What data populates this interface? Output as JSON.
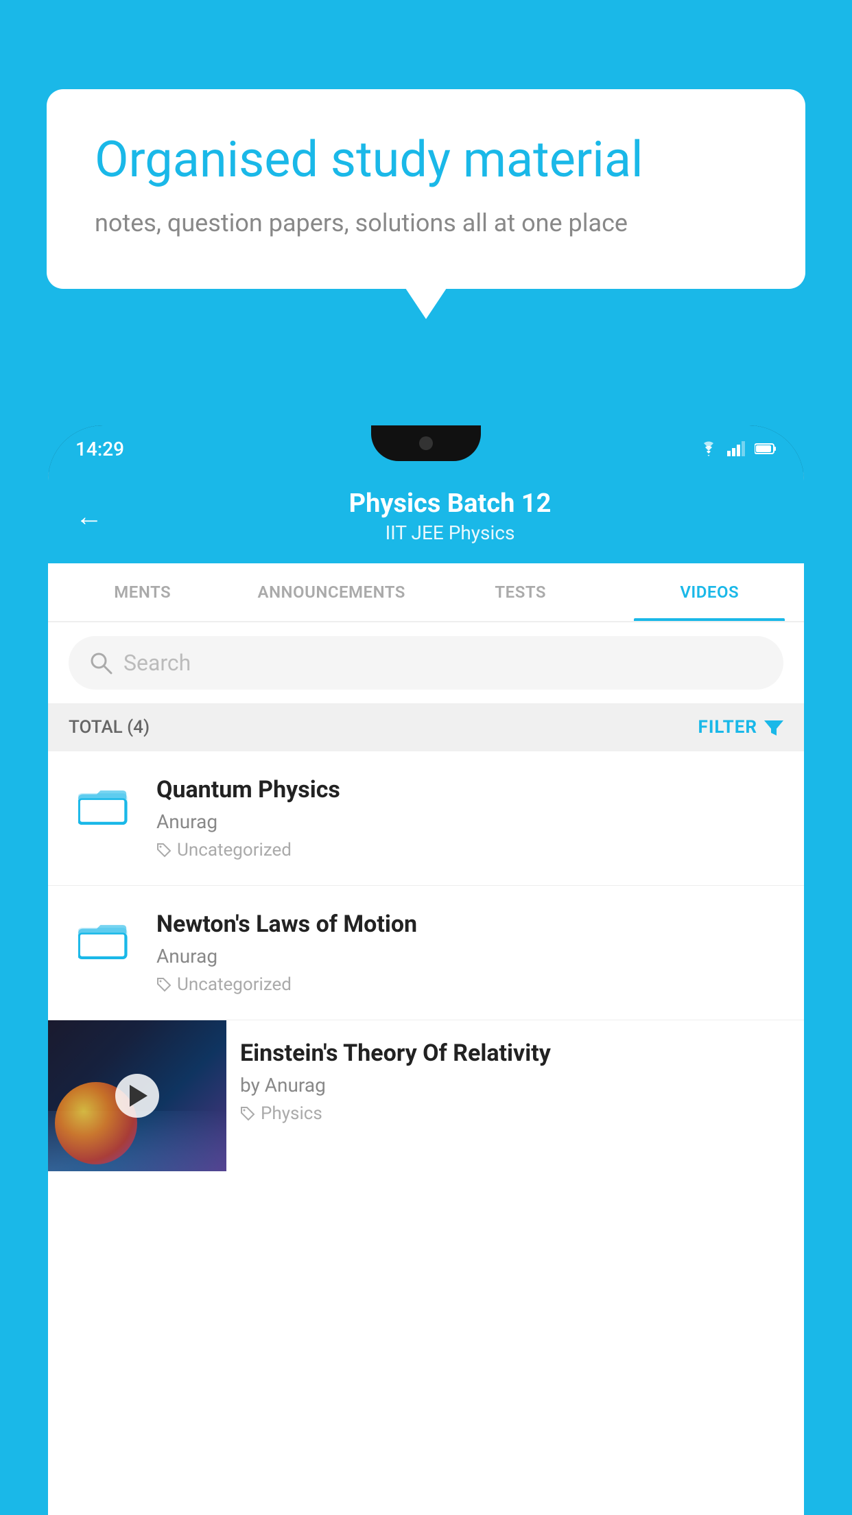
{
  "background_color": "#1ab8e8",
  "bubble": {
    "title": "Organised study material",
    "subtitle": "notes, question papers, solutions all at one place"
  },
  "status_bar": {
    "time": "14:29",
    "icons": [
      "wifi",
      "signal",
      "battery"
    ]
  },
  "header": {
    "title": "Physics Batch 12",
    "subtitle": "IIT JEE    Physics",
    "back_label": "←"
  },
  "tabs": [
    {
      "label": "MENTS",
      "active": false
    },
    {
      "label": "ANNOUNCEMENTS",
      "active": false
    },
    {
      "label": "TESTS",
      "active": false
    },
    {
      "label": "VIDEOS",
      "active": true
    }
  ],
  "search": {
    "placeholder": "Search"
  },
  "filter_bar": {
    "total_label": "TOTAL (4)",
    "filter_label": "FILTER"
  },
  "videos": [
    {
      "title": "Quantum Physics",
      "author": "Anurag",
      "tag": "Uncategorized",
      "has_thumbnail": false
    },
    {
      "title": "Newton's Laws of Motion",
      "author": "Anurag",
      "tag": "Uncategorized",
      "has_thumbnail": false
    },
    {
      "title": "Einstein's Theory Of Relativity",
      "author": "by Anurag",
      "tag": "Physics",
      "has_thumbnail": true
    }
  ]
}
